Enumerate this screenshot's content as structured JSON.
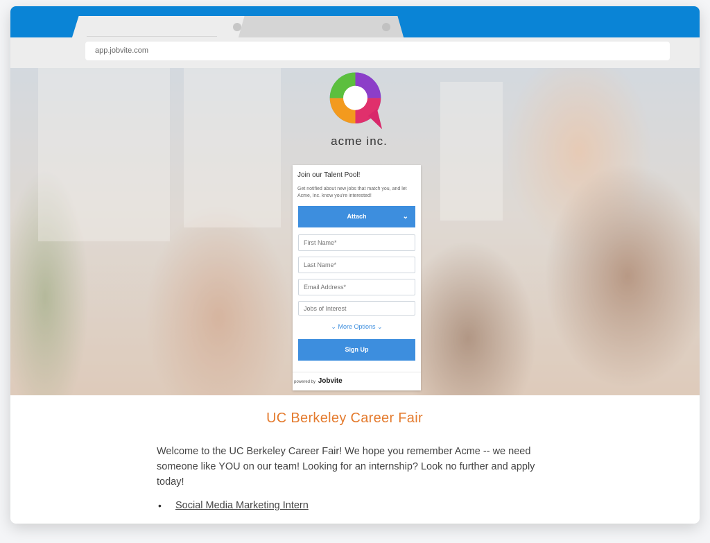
{
  "browser": {
    "address": "app.jobvite.com"
  },
  "brand": {
    "name": "acme inc.",
    "logo_icon": "speech-bubble-logo-icon"
  },
  "form": {
    "title": "Join our Talent Pool!",
    "subtitle": "Get notified about new jobs that match you, and let Acme, Inc. know you're interested!",
    "attach_label": "Attach",
    "fields": [
      {
        "placeholder": "First Name*"
      },
      {
        "placeholder": "Last Name*"
      },
      {
        "placeholder": "Email Address*"
      },
      {
        "placeholder": "Jobs of Interest"
      }
    ],
    "more_options": "More Options",
    "signup_label": "Sign Up",
    "powered_by": "powered by",
    "powered_brand": "Jobvite"
  },
  "content": {
    "title": "UC Berkeley Career Fair",
    "text": "Welcome to the UC Berkeley Career Fair! We hope you remember Acme -- we need someone like YOU on our team! Looking for an internship? Look no further and apply today!",
    "jobs": [
      "Social Media Marketing Intern"
    ]
  },
  "colors": {
    "tabbar": "#0a84d6",
    "accent_button": "#3d8ede",
    "title_orange": "#e47b2e"
  }
}
